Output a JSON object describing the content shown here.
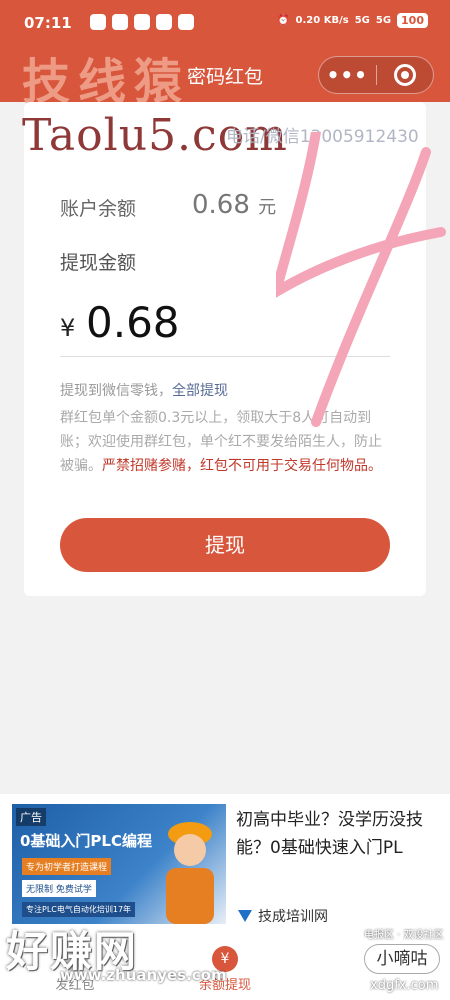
{
  "status_bar": {
    "time": "07:11",
    "network": "0.20 KB/s",
    "signal1": "5G",
    "signal2": "5G",
    "battery": "100"
  },
  "navbar": {
    "title": "密码红包",
    "more_label": "•••",
    "color": "#d8563c"
  },
  "watermarks": {
    "top_chinese": "技线猿",
    "site": "Taolu5.com",
    "contact": "电话/微信13005912430",
    "bottom_chinese": "好赚网",
    "bottom_url": "www.zhuanyes.com",
    "br_small": "电报区 · 双设社区",
    "br_badge": "小嘀咕",
    "br_url": "xdgfx.com"
  },
  "account": {
    "balance_label": "账户余额",
    "balance_value": "0.68",
    "balance_unit": "元",
    "amount_label": "提现金额",
    "currency_symbol": "¥",
    "amount_value": "0.68"
  },
  "withdraw_info": {
    "to_wechat": "提现到微信零钱，",
    "all_label": "全部提现",
    "notice_normal": "群红包单个金额0.3元以上，领取大于8人可自动到账；欢迎使用群红包，单个红不要发给陌生人，防止被骗。",
    "notice_warning": "严禁招赌参赌，红包不可用于交易任何物品。"
  },
  "withdraw_button": "提现",
  "ad": {
    "tag": "广告",
    "image_headline": "0基础入门PLC编程",
    "image_ribbon": "专为初学者打造课程",
    "image_line2": "无限制 免费试学",
    "image_line3": "专注PLC电气自动化培训17年",
    "text": "初高中毕业？没学历没技能？0基础快速入门PL",
    "brand": "技成培训网"
  },
  "tabs": [
    {
      "label": "发红包",
      "icon": "red-packet-icon"
    },
    {
      "label": "余额提现",
      "icon": "yen-icon"
    }
  ]
}
